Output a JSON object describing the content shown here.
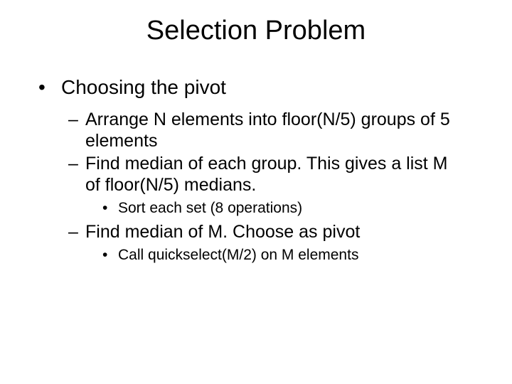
{
  "title": "Selection Problem",
  "l1": {
    "text": "Choosing the pivot"
  },
  "l2a": "Arrange N elements into floor(N/5) groups of 5 elements",
  "l2b": "Find median of each group.  This gives a list M of floor(N/5) medians.",
  "l3a": "Sort each set (8 operations)",
  "l2c": "Find median of M.  Choose as pivot",
  "l3b": "Call quickselect(M/2) on M elements"
}
